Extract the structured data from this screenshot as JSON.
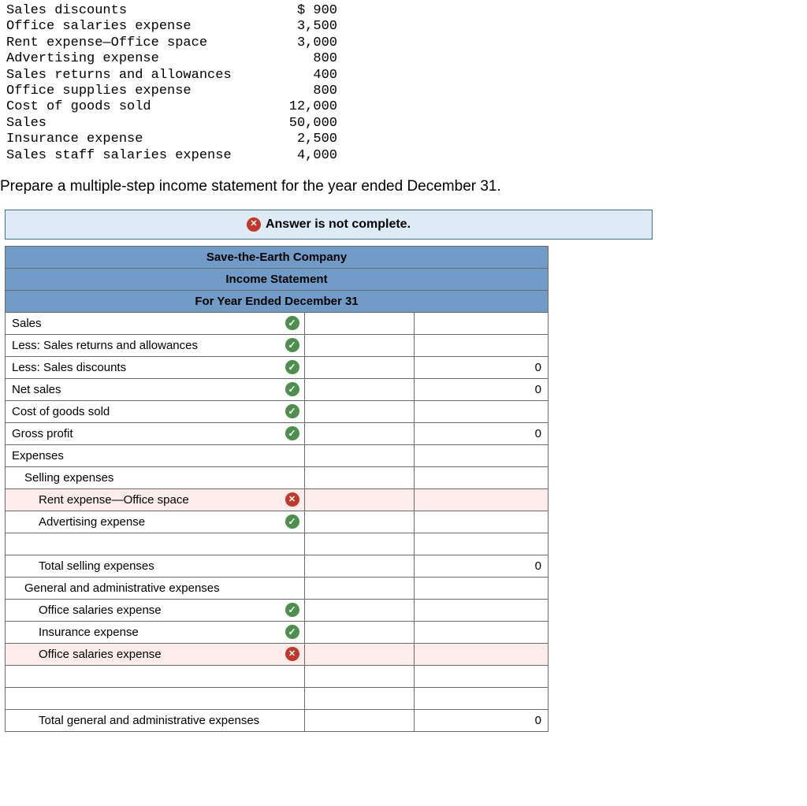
{
  "ledger": [
    {
      "label": "Sales discounts",
      "value": "$ 900"
    },
    {
      "label": "Office salaries expense",
      "value": "3,500"
    },
    {
      "label": "Rent expense—Office space",
      "value": "3,000"
    },
    {
      "label": "Advertising expense",
      "value": "800"
    },
    {
      "label": "Sales returns and allowances",
      "value": "400"
    },
    {
      "label": "Office supplies expense",
      "value": "800"
    },
    {
      "label": "Cost of goods sold",
      "value": "12,000"
    },
    {
      "label": "Sales",
      "value": "50,000"
    },
    {
      "label": "Insurance expense",
      "value": "2,500"
    },
    {
      "label": "Sales staff salaries expense",
      "value": "4,000"
    }
  ],
  "instruction": "Prepare a multiple-step income statement for the year ended December 31.",
  "banner": "Answer is not complete.",
  "header": {
    "company": "Save-the-Earth Company",
    "title": "Income Statement",
    "period": "For Year Ended December 31"
  },
  "rows": [
    {
      "label": "Sales",
      "indent": 0,
      "mark": "check",
      "amt1": "",
      "amt2": ""
    },
    {
      "label": "Less: Sales returns and allowances",
      "indent": 0,
      "mark": "check",
      "amt1": "",
      "amt2": ""
    },
    {
      "label": "Less: Sales discounts",
      "indent": 0,
      "mark": "check",
      "amt1": "",
      "amt2": "0"
    },
    {
      "label": "Net sales",
      "indent": 0,
      "mark": "check",
      "amt1": "",
      "amt2": "0"
    },
    {
      "label": "Cost of goods sold",
      "indent": 0,
      "mark": "check",
      "amt1": "",
      "amt2": ""
    },
    {
      "label": "Gross profit",
      "indent": 0,
      "mark": "check",
      "amt1": "",
      "amt2": "0"
    },
    {
      "label": "Expenses",
      "indent": 0,
      "mark": "",
      "amt1": "",
      "amt2": ""
    },
    {
      "label": "Selling expenses",
      "indent": 1,
      "mark": "",
      "amt1": "",
      "amt2": ""
    },
    {
      "label": "Rent expense—Office space",
      "indent": 2,
      "mark": "x",
      "amt1": "",
      "amt2": "",
      "wrong": true
    },
    {
      "label": "Advertising expense",
      "indent": 2,
      "mark": "check",
      "amt1": "",
      "amt2": ""
    },
    {
      "label": "",
      "indent": 0,
      "mark": "",
      "amt1": "",
      "amt2": ""
    },
    {
      "label": "Total selling expenses",
      "indent": 2,
      "mark": "",
      "amt1": "",
      "amt2": "0"
    },
    {
      "label": "General and administrative expenses",
      "indent": 1,
      "mark": "",
      "amt1": "",
      "amt2": ""
    },
    {
      "label": "Office salaries expense",
      "indent": 2,
      "mark": "check",
      "amt1": "",
      "amt2": ""
    },
    {
      "label": "Insurance expense",
      "indent": 2,
      "mark": "check",
      "amt1": "",
      "amt2": ""
    },
    {
      "label": "Office salaries expense",
      "indent": 2,
      "mark": "x",
      "amt1": "",
      "amt2": "",
      "wrong": true
    },
    {
      "label": "",
      "indent": 0,
      "mark": "",
      "amt1": "",
      "amt2": ""
    },
    {
      "label": "",
      "indent": 0,
      "mark": "",
      "amt1": "",
      "amt2": ""
    },
    {
      "label": "Total general and administrative expenses",
      "indent": 2,
      "mark": "",
      "amt1": "",
      "amt2": "0"
    }
  ]
}
